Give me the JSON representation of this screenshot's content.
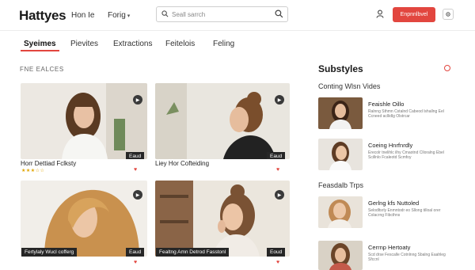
{
  "header": {
    "logo": "Hattyes",
    "nav": [
      {
        "label": "Hon Ie"
      },
      {
        "label": "Forig"
      }
    ],
    "search": {
      "placeholder": "Seall sarrch"
    },
    "signup_label": "Enpnnlbvel"
  },
  "tabs": [
    {
      "label": "Syeimes",
      "active": true
    },
    {
      "label": "Pievites",
      "active": false
    },
    {
      "label": "Extractions",
      "active": false
    },
    {
      "label": "Feitelois",
      "active": false
    },
    {
      "label": "Feling",
      "active": false
    }
  ],
  "section_label": "FNE EALCES",
  "cards": [
    {
      "title": "Horr Dettiad Fclksty",
      "tag": "Eaud",
      "rating": 3
    },
    {
      "title": "Liey Hor Cofteiding",
      "tag": "Eaud",
      "rating": 0
    },
    {
      "title": "Fertylaly Wucl cofferg",
      "tag": "Eaud",
      "rating": 0
    },
    {
      "title": "Fealtng Amn Detrod Fasstonl",
      "tag": "Eoud",
      "rating": 0
    }
  ],
  "sidebar": {
    "title": "Substyles",
    "groups": [
      {
        "label": "Conting Wlsn Vides",
        "items": [
          {
            "name": "Feaishle Oillo",
            "desc": "Ralnng Sthmn Cstalnd Cabeod lshallng Eel Ccneed acllidlg Olstrcar"
          },
          {
            "name": "Coeing Hnrfnrdly",
            "desc": "Erecolr tnelihlc ilhy Cmaotnd Clloralng Ebel Scillnlo Fcaleotd Scmfoy"
          }
        ]
      },
      {
        "label": "Feasdalb Trps",
        "items": [
          {
            "name": "Gerlng kfs Nuttoled",
            "desc": "Selodltsrly Enmntodr eo Sllong tilloal orer Colacrng Fibcthns"
          },
          {
            "name": "Cerrnp Hertoaty",
            "desc": "Scd drse Fescalle Cotnlnng Sbalng Eaahleg Sfccnl"
          }
        ]
      }
    ]
  },
  "colors": {
    "accent": "#e2463f",
    "star": "#e0a400"
  }
}
